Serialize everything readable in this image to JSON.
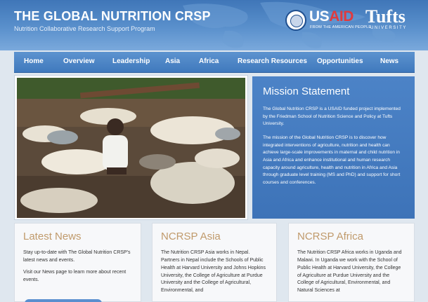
{
  "header": {
    "title": "THE GLOBAL NUTRITION CRSP",
    "subtitle": "Nutrition Collaborative Research Support Program",
    "usaid": {
      "us": "US",
      "aid": "AID",
      "tagline": "FROM THE AMERICAN PEOPLE"
    },
    "tufts": {
      "name": "Tufts",
      "tagline": "UNIVERSITY"
    }
  },
  "nav": {
    "items": [
      "Home",
      "Overview",
      "Leadership",
      "Asia",
      "Africa",
      "Research Resources",
      "Opportunities",
      "News"
    ]
  },
  "mission": {
    "title": "Mission Statement",
    "paragraphs": [
      "The Global Nutrition CRSP is a USAID funded project implemented by the Friedman School of Nutrition Science and Policy at Tufts University.",
      "The mission of the Global Nutrition CRSP is to discover how integrated interventions of agriculture, nutrition and health can achieve large-scale improvements in maternal and child nutrition in Asia and Africa and enhance institutional and human research capacity around agriculture, health and nutrition in Africa and Asia through graduate level training (MS and PhD) and support for short courses and conferences."
    ]
  },
  "cards": [
    {
      "title": "Latest News",
      "paragraphs": [
        "Stay up-to-date with The Global Nutrition CRSP's latest news and events.",
        "Visit our News page to learn more about recent events."
      ]
    },
    {
      "title": "NCRSP Asia",
      "paragraphs": [
        "The Nutrition CRSP Asia works in Nepal. Partners in Nepal include the Schools of Public Health at Harvard University and Johns Hopkins University, the College of Agriculture at Purdue University and the College of Agricultural, Environmental, and"
      ]
    },
    {
      "title": "NCRSP Africa",
      "paragraphs": [
        "The Nutrition CRSP Africa works in Uganda and Malawi.   In Uganda we work with the School of Public Health at Harvard University, the College of Agriculture at Purdue University and the College of Agricultural, Environmental, and Natural Sciences at"
      ]
    }
  ],
  "colors": {
    "header_blue": "#4a82c2",
    "nav_blue": "#3f79bd",
    "mission_blue": "#4479bd",
    "card_heading_tan": "#c09a6b",
    "usaid_red": "#e03a3e"
  }
}
